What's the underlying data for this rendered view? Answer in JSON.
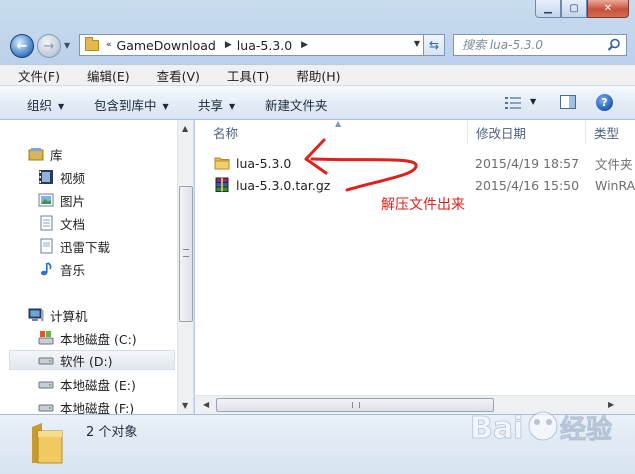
{
  "window": {
    "caption_buttons": [
      "minimize",
      "maximize",
      "close"
    ]
  },
  "address_bar": {
    "chevron": "«",
    "segments": [
      "GameDownload",
      "lua-5.3.0"
    ]
  },
  "search": {
    "placeholder": "搜索 lua-5.3.0"
  },
  "menu": [
    "文件(F)",
    "编辑(E)",
    "查看(V)",
    "工具(T)",
    "帮助(H)"
  ],
  "commands": {
    "organize": "组织",
    "include_library": "包含到库中",
    "share": "共享",
    "new_folder": "新建文件夹"
  },
  "nav_pane": {
    "libraries": {
      "label": "库",
      "items": [
        "视频",
        "图片",
        "文档",
        "迅雷下载",
        "音乐"
      ]
    },
    "computer": {
      "label": "计算机",
      "drives": [
        "本地磁盘 (C:)",
        "软件 (D:)",
        "本地磁盘 (E:)",
        "本地磁盘 (F:)"
      ],
      "selected": "软件 (D:)"
    }
  },
  "columns": [
    "名称",
    "修改日期",
    "类型"
  ],
  "files": [
    {
      "name": "lua-5.3.0",
      "date": "2015/4/19 18:57",
      "type": "文件夹",
      "icon": "folder-icon"
    },
    {
      "name": "lua-5.3.0.tar.gz",
      "date": "2015/4/16 15:50",
      "type": "WinRAR",
      "icon": "winrar-archive-icon"
    }
  ],
  "annotation": {
    "text": "解压文件出来",
    "color": "#e0201b"
  },
  "details": {
    "count": "2 个对象"
  },
  "watermark": {
    "text": "Bai 经验"
  }
}
